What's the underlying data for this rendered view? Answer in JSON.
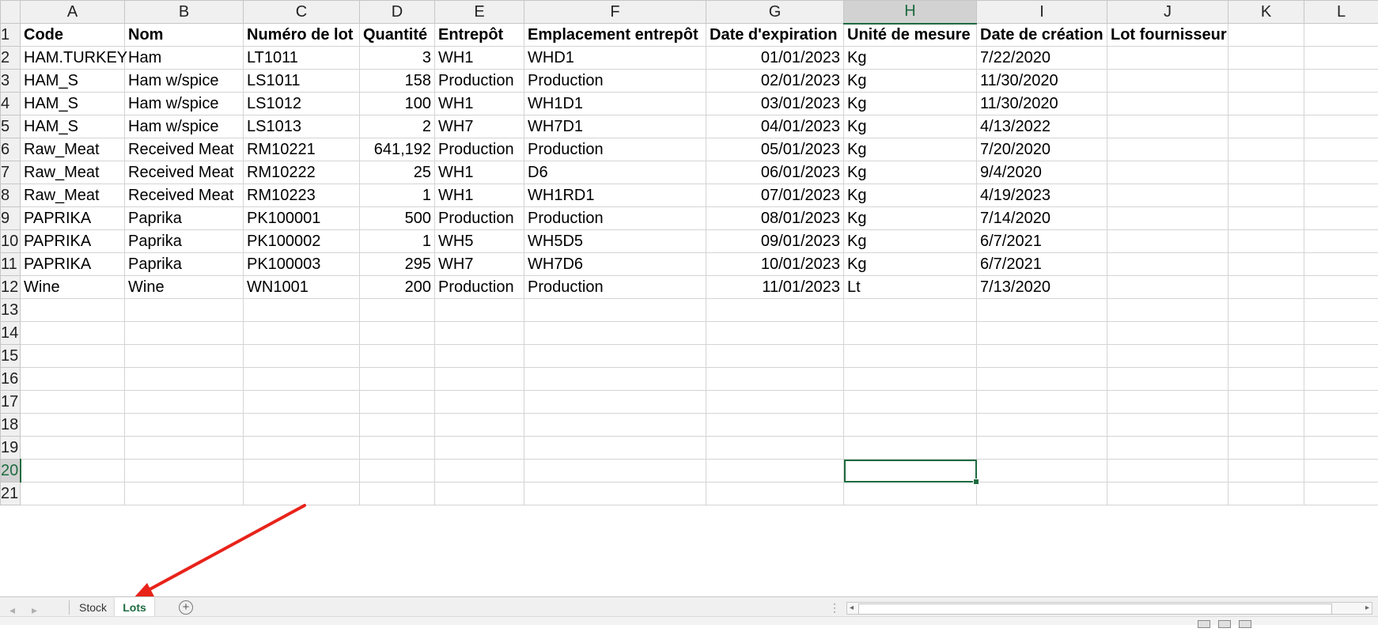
{
  "columns": [
    "A",
    "B",
    "C",
    "D",
    "E",
    "F",
    "G",
    "H",
    "I",
    "J",
    "K",
    "L"
  ],
  "active_column": "H",
  "active_row": "20",
  "selected_cell": "H20",
  "headers": [
    "Code",
    "Nom",
    "Numéro de lot",
    "Quantité",
    "Entrepôt",
    "Emplacement entrepôt",
    "Date d'expiration",
    "Unité de mesure",
    "Date de création",
    "Lot fournisseur"
  ],
  "rows": [
    [
      "HAM.TURKEY",
      "Ham",
      "LT1011",
      "3",
      "WH1",
      "WHD1",
      "01/01/2023",
      "Kg",
      "7/22/2020",
      ""
    ],
    [
      "HAM_S",
      "Ham w/spice",
      "LS1011",
      "158",
      "Production",
      "Production",
      "02/01/2023",
      "Kg",
      "11/30/2020",
      ""
    ],
    [
      "HAM_S",
      "Ham w/spice",
      "LS1012",
      "100",
      "WH1",
      "WH1D1",
      "03/01/2023",
      "Kg",
      "11/30/2020",
      ""
    ],
    [
      "HAM_S",
      "Ham w/spice",
      "LS1013",
      "2",
      "WH7",
      "WH7D1",
      "04/01/2023",
      "Kg",
      "4/13/2022",
      ""
    ],
    [
      "Raw_Meat",
      "Received Meat",
      "RM10221",
      "641,192",
      "Production",
      "Production",
      "05/01/2023",
      "Kg",
      "7/20/2020",
      ""
    ],
    [
      "Raw_Meat",
      "Received Meat",
      "RM10222",
      "25",
      "WH1",
      "D6",
      "06/01/2023",
      "Kg",
      "9/4/2020",
      ""
    ],
    [
      "Raw_Meat",
      "Received Meat",
      "RM10223",
      "1",
      "WH1",
      "WH1RD1",
      "07/01/2023",
      "Kg",
      "4/19/2023",
      ""
    ],
    [
      "PAPRIKA",
      "Paprika",
      "PK100001",
      "500",
      "Production",
      "Production",
      "08/01/2023",
      "Kg",
      "7/14/2020",
      ""
    ],
    [
      "PAPRIKA",
      "Paprika",
      "PK100002",
      "1",
      "WH5",
      "WH5D5",
      "09/01/2023",
      "Kg",
      "6/7/2021",
      ""
    ],
    [
      "PAPRIKA",
      "Paprika",
      "PK100003",
      "295",
      "WH7",
      "WH7D6",
      "10/01/2023",
      "Kg",
      "6/7/2021",
      ""
    ],
    [
      "Wine",
      "Wine",
      "WN1001",
      "200",
      "Production",
      "Production",
      "11/01/2023",
      "Lt",
      "7/13/2020",
      ""
    ]
  ],
  "row_numbers": [
    "1",
    "2",
    "3",
    "4",
    "5",
    "6",
    "7",
    "8",
    "9",
    "10",
    "11",
    "12",
    "13",
    "14",
    "15",
    "16",
    "17",
    "18",
    "19",
    "20",
    "21"
  ],
  "right_aligned_columns": [
    3,
    6
  ],
  "sheet_tabs": [
    {
      "label": "Stock",
      "active": false
    },
    {
      "label": "Lots",
      "active": true
    }
  ],
  "colors": {
    "accent": "#1e6b40",
    "annotation_arrow": "#e8231a",
    "grid_line": "#d4d4d4",
    "header_bg": "#f0f0f0"
  },
  "icons": {
    "add_sheet": "plus-circle-icon",
    "nav_prev": "caret-left-icon",
    "nav_next": "caret-right-icon"
  }
}
